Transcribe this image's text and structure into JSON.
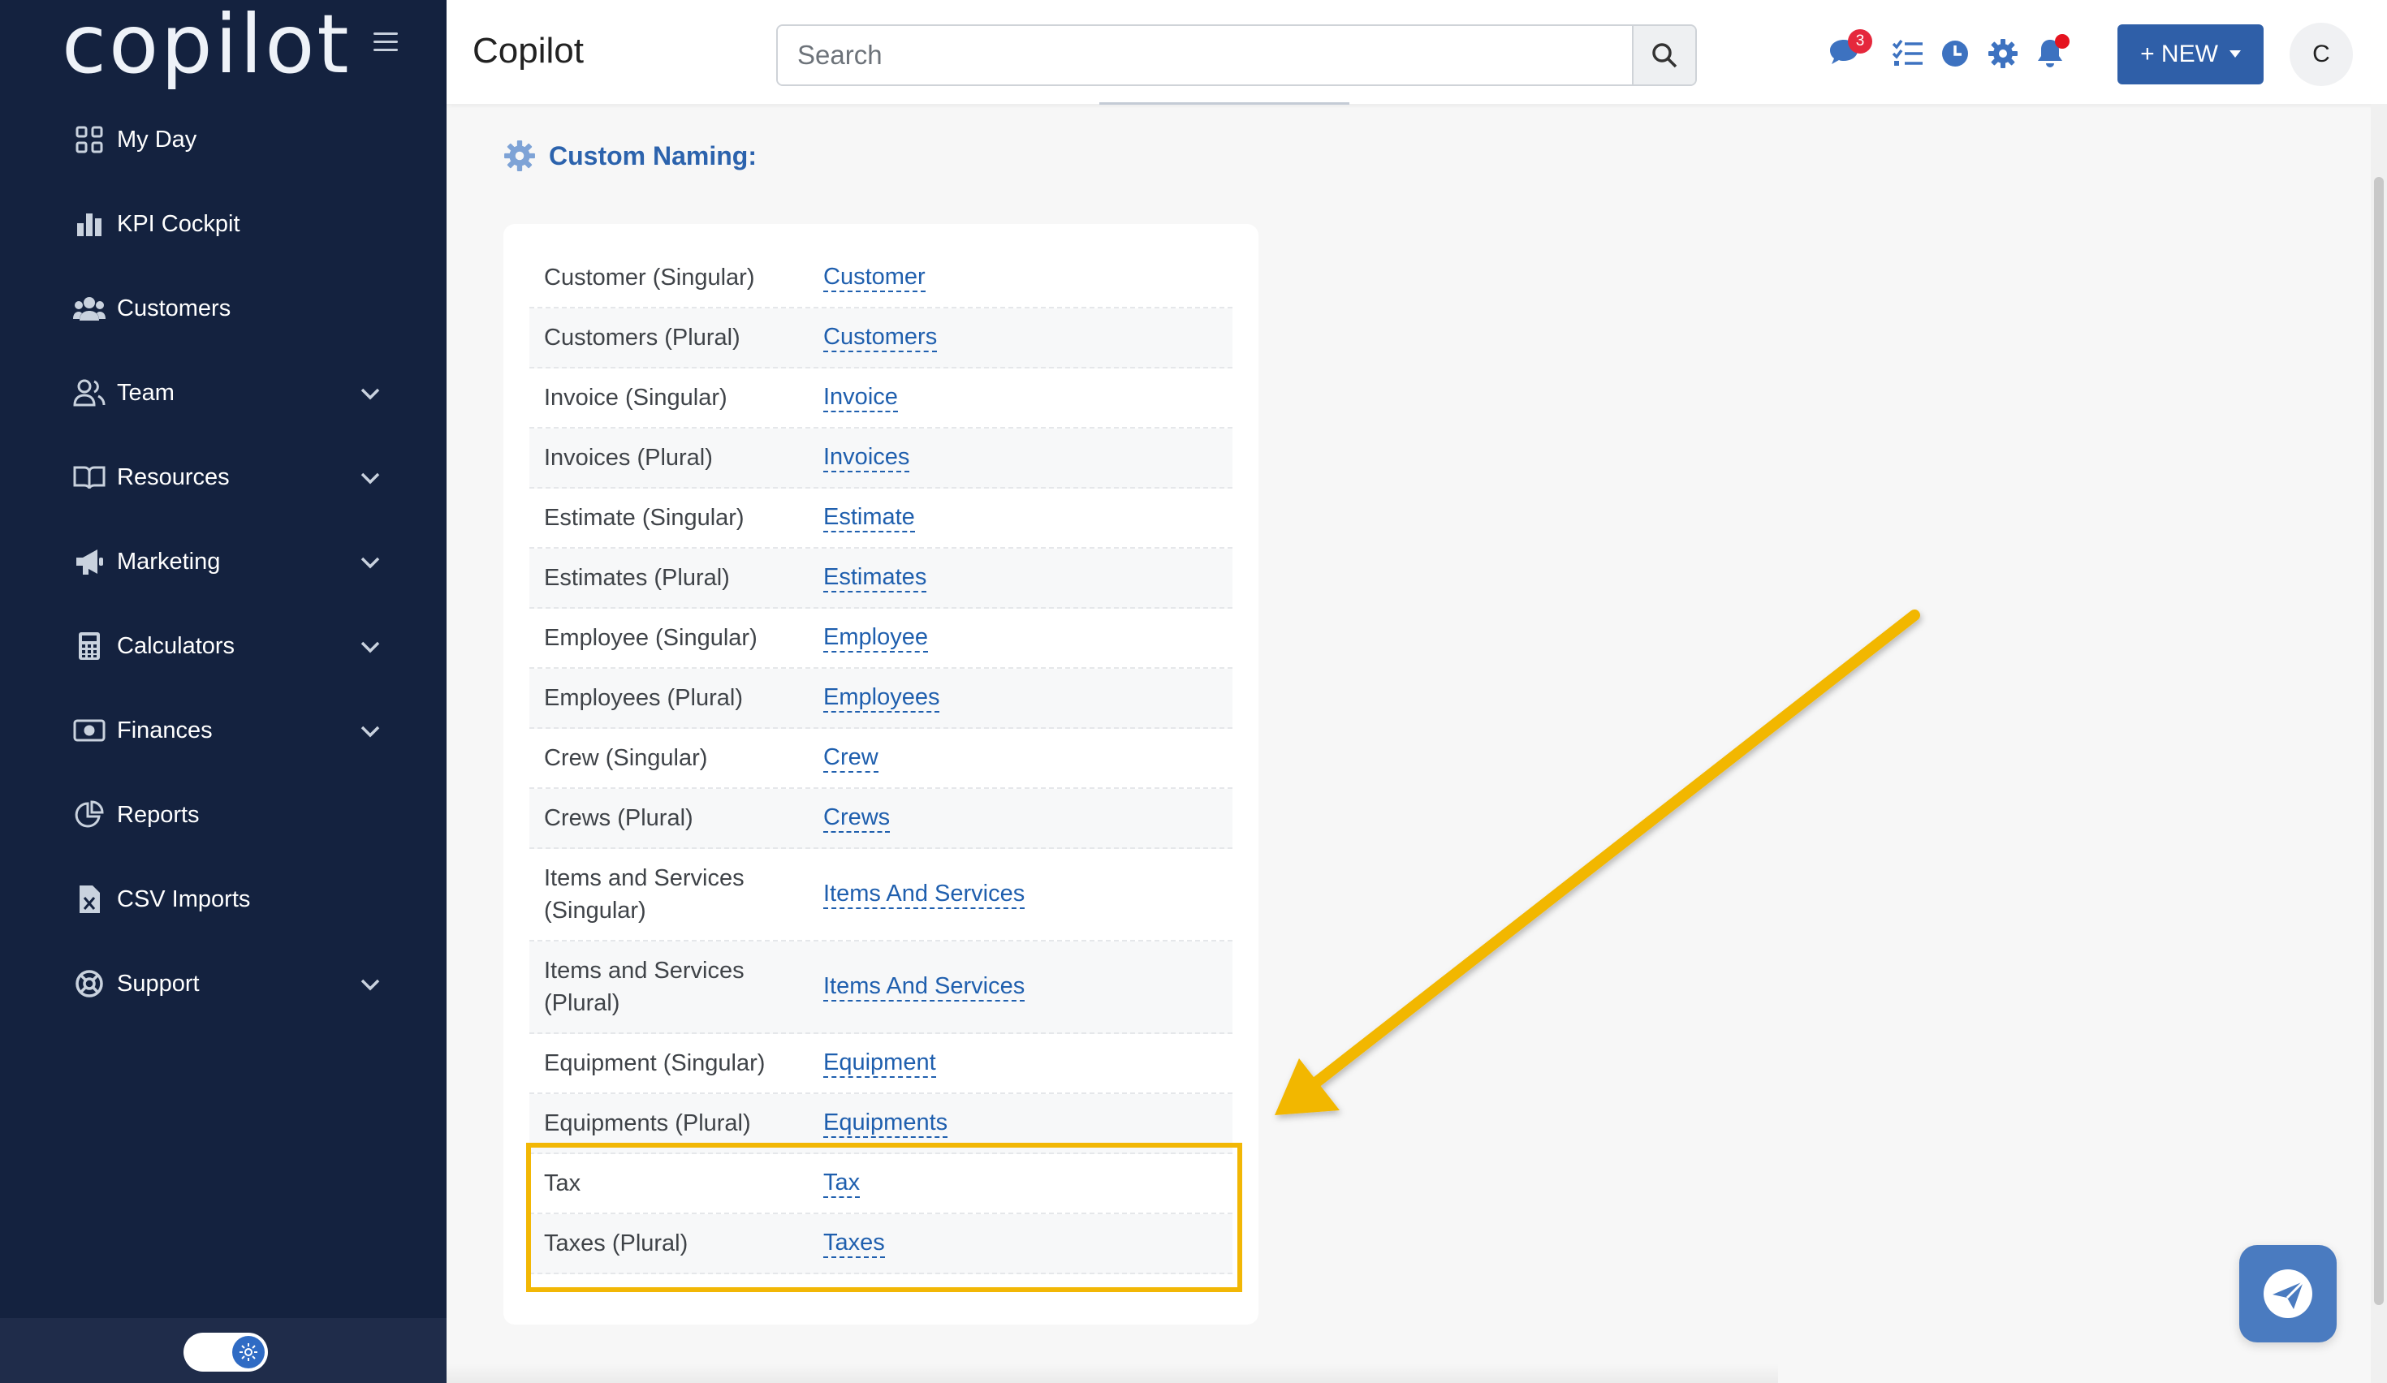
{
  "sidebar": {
    "logo": "copilot",
    "items": [
      {
        "label": "My Day",
        "icon": "grid-icon"
      },
      {
        "label": "KPI Cockpit",
        "icon": "bar-chart-icon"
      },
      {
        "label": "Customers",
        "icon": "users-icon"
      },
      {
        "label": "Team",
        "icon": "team-icon",
        "expandable": true
      },
      {
        "label": "Resources",
        "icon": "book-icon",
        "expandable": true
      },
      {
        "label": "Marketing",
        "icon": "megaphone-icon",
        "expandable": true
      },
      {
        "label": "Calculators",
        "icon": "calculator-icon",
        "expandable": true
      },
      {
        "label": "Finances",
        "icon": "money-icon",
        "expandable": true
      },
      {
        "label": "Reports",
        "icon": "pie-chart-icon"
      },
      {
        "label": "CSV Imports",
        "icon": "file-csv-icon"
      },
      {
        "label": "Support",
        "icon": "lifebuoy-icon",
        "expandable": true
      }
    ]
  },
  "header": {
    "title": "Copilot",
    "search_placeholder": "Search",
    "chat_badge": "3",
    "new_button": "+ NEW",
    "avatar_initial": "C"
  },
  "section": {
    "title": "Custom Naming:"
  },
  "naming_rows": [
    {
      "label": "Customer (Singular)",
      "value": "Customer"
    },
    {
      "label": "Customers (Plural)",
      "value": "Customers"
    },
    {
      "label": "Invoice (Singular)",
      "value": "Invoice"
    },
    {
      "label": "Invoices (Plural)",
      "value": "Invoices"
    },
    {
      "label": "Estimate (Singular)",
      "value": "Estimate"
    },
    {
      "label": "Estimates (Plural)",
      "value": "Estimates"
    },
    {
      "label": "Employee (Singular)",
      "value": "Employee"
    },
    {
      "label": "Employees (Plural)",
      "value": "Employees"
    },
    {
      "label": "Crew (Singular)",
      "value": "Crew"
    },
    {
      "label": "Crews (Plural)",
      "value": "Crews"
    },
    {
      "label": "Items and Services (Singular)",
      "value": "Items And Services"
    },
    {
      "label": "Items and Services (Plural)",
      "value": "Items And Services"
    },
    {
      "label": "Equipment (Singular)",
      "value": "Equipment"
    },
    {
      "label": "Equipments (Plural)",
      "value": "Equipments"
    },
    {
      "label": "Tax",
      "value": "Tax"
    },
    {
      "label": "Taxes (Plural)",
      "value": "Taxes"
    }
  ],
  "colors": {
    "sidebar_bg": "#14223f",
    "accent": "#2f5fa8",
    "link": "#1f5fae",
    "highlight": "#f2b705"
  }
}
